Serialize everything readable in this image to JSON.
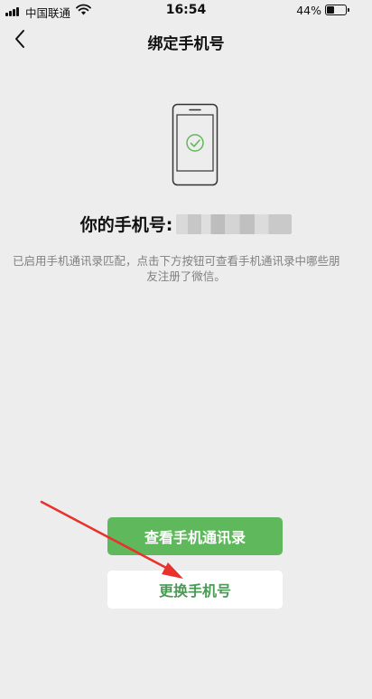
{
  "status_bar": {
    "carrier": "中国联通",
    "time": "16:54",
    "battery_percent": "44%",
    "battery_level": 0.44
  },
  "nav": {
    "title": "绑定手机号",
    "back_icon": "chevron-left-icon"
  },
  "illustration": {
    "icon": "phone-check-icon",
    "accent_color": "#5fb95c"
  },
  "phone": {
    "label": "你的手机号:",
    "number_masked": true
  },
  "description": {
    "line1": "已启用手机通讯录匹配，点击下方按钮可查看手机通讯录中哪些朋",
    "line2": "友注册了微信。"
  },
  "buttons": {
    "view_contacts": "查看手机通讯录",
    "change_phone": "更换手机号"
  },
  "colors": {
    "primary_green": "#5fb95c",
    "secondary_text_green": "#4a9a55",
    "background": "#ededed",
    "annotation_red": "#e8322b"
  }
}
